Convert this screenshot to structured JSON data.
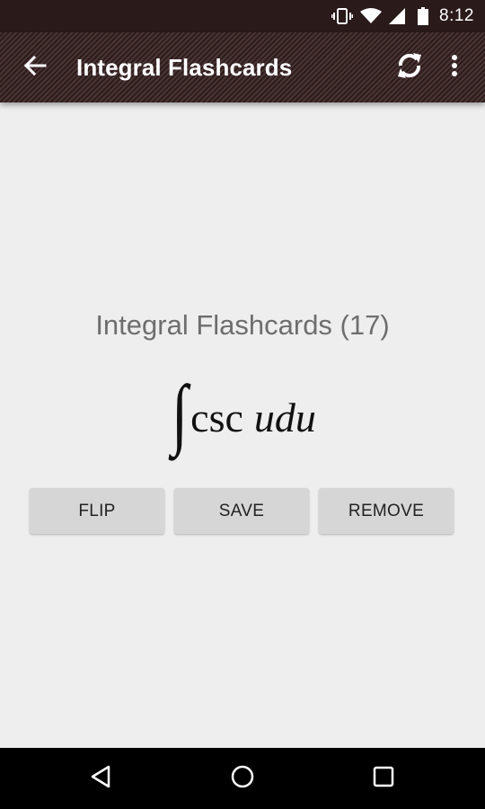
{
  "status_bar": {
    "time": "8:12",
    "icons": [
      "vibrate-icon",
      "wifi-icon",
      "cell-signal-icon",
      "battery-icon"
    ]
  },
  "app_bar": {
    "title": "Integral Flashcards",
    "back_icon": "arrow-back-icon",
    "actions": [
      "refresh-icon",
      "overflow-menu-icon"
    ]
  },
  "card": {
    "deck_title": "Integral Flashcards (17)",
    "formula": {
      "integral_symbol": "∫",
      "function": "csc",
      "variable": "udu"
    }
  },
  "buttons": {
    "flip": "FLIP",
    "save": "SAVE",
    "remove": "REMOVE"
  },
  "nav_bar": {
    "icons": [
      "nav-back-icon",
      "nav-home-icon",
      "nav-recents-icon"
    ]
  }
}
